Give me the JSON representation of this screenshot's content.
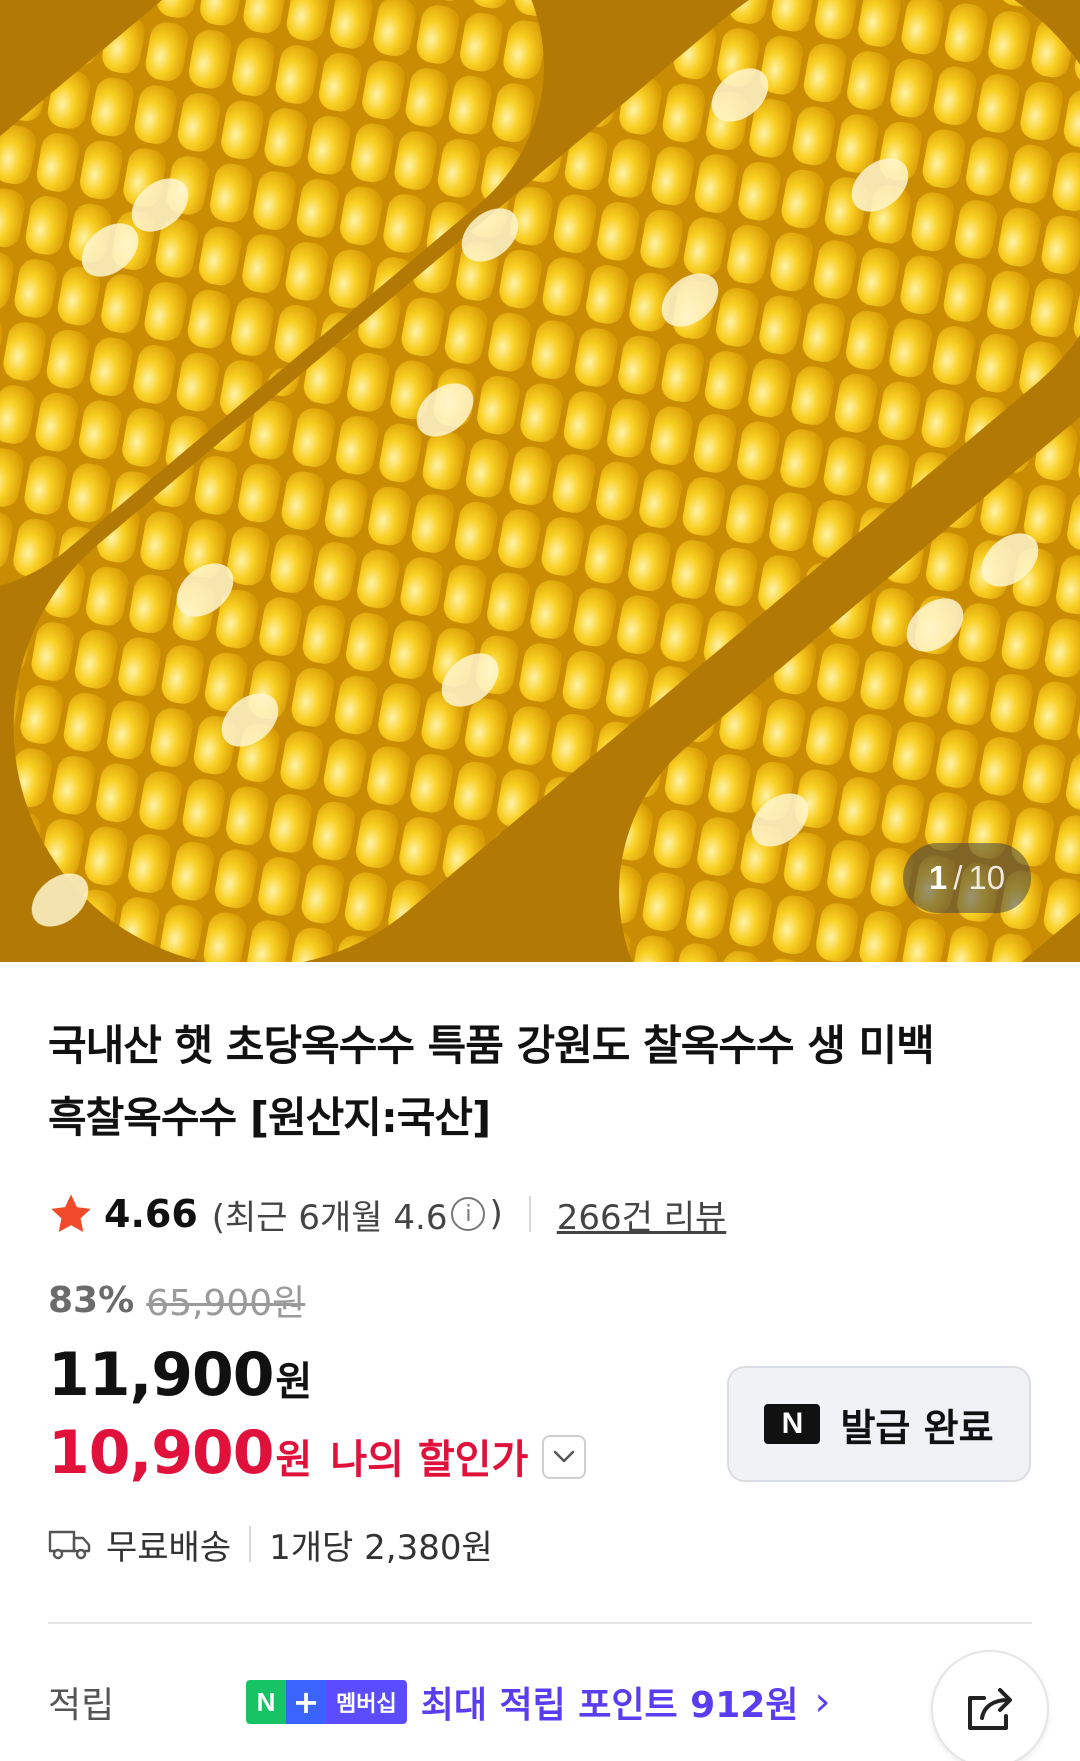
{
  "gallery": {
    "current": "1",
    "separator": "/",
    "total": "10"
  },
  "product": {
    "title_line1": "국내산 햇 초당옥수수 특품 강원도 찰옥수수 생 미백",
    "title_line2": "흑찰옥수수 [원산지:국산]"
  },
  "rating": {
    "icon": "star-icon",
    "value": "4.66",
    "recent_prefix": "(최근 6개월 4.6",
    "recent_suffix": ")",
    "info_icon": "info-icon",
    "review_link": "266건 리뷰"
  },
  "price": {
    "discount_rate": "83%",
    "original_price": "65,900원",
    "sale_price": "11,900",
    "sale_currency": "원",
    "my_price": "10,900",
    "my_currency": "원",
    "my_price_label": "나의 할인가"
  },
  "coupon": {
    "badge": "N",
    "label": "발급 완료"
  },
  "delivery": {
    "icon": "truck-icon",
    "shipping": "무료배송",
    "unit_price": "1개당 2,380원"
  },
  "points": {
    "label": "적립",
    "badge_n": "N",
    "badge_plus": "+",
    "badge_text": "멤버십",
    "text": "최대 적립 포인트 912원",
    "chevron": "›"
  },
  "share": {
    "icon": "share-icon"
  },
  "colors": {
    "accent_red": "#e0123c",
    "points_purple": "#5a3df0",
    "star": "#f04a2a"
  }
}
